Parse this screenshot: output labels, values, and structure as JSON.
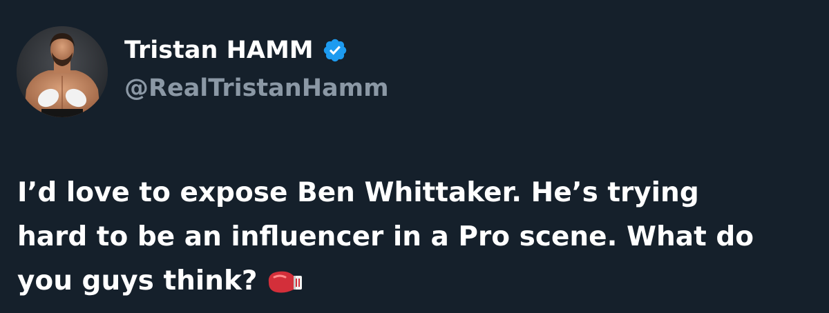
{
  "author": {
    "display_name": "Tristan HAMM",
    "handle": "@RealTristanHamm",
    "verified": true,
    "verified_color": "#1d9bf0"
  },
  "avatar": {
    "icon": "profile-photo"
  },
  "tweet": {
    "lines": [
      "I’d love to expose Ben Whittaker. He’s trying",
      "hard to be an influencer in a Pro scene. What do",
      "you guys think?"
    ],
    "emoji": "boxing-glove-icon"
  },
  "theme": {
    "background": "#15202b",
    "text": "#ffffff",
    "secondary_text": "#8b98a5"
  }
}
